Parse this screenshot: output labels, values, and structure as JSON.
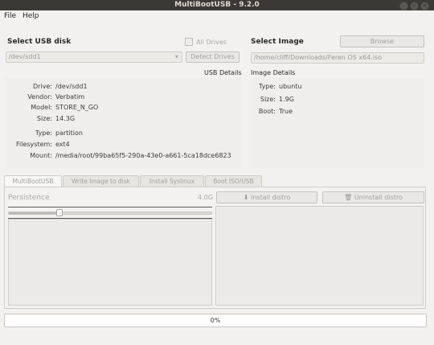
{
  "window": {
    "title": "MultiBootUSB - 9.2.0"
  },
  "menu": {
    "file": "File",
    "help": "Help"
  },
  "usb": {
    "section_label": "Select USB disk",
    "all_drives_label": "All Drives",
    "selected_disk": "/dev/sdd1",
    "detect_button": "Detect Drives",
    "details_label": "USB Details",
    "details": [
      {
        "label": "Drive:",
        "value": "/dev/sdd1"
      },
      {
        "label": "Vendor:",
        "value": "Verbatim"
      },
      {
        "label": "Model:",
        "value": "STORE_N_GO"
      },
      {
        "label": "Size:",
        "value": "14.3G"
      },
      {
        "label": "Type:",
        "value": "partition"
      },
      {
        "label": "Filesystem:",
        "value": "ext4"
      },
      {
        "label": "Mount:",
        "value": "/media/root/99ba65f5-290a-43e0-a661-5ca18dce6823"
      }
    ]
  },
  "image": {
    "section_label": "Select Image",
    "browse_button": "Browse",
    "path": "/home/cliff/Downloads/Feren OS x64.iso",
    "details_label": "Image Details",
    "details": [
      {
        "label": "Type:",
        "value": "ubuntu"
      },
      {
        "label": "Size:",
        "value": "1.9G"
      },
      {
        "label": "Boot:",
        "value": "True"
      }
    ]
  },
  "tabs": [
    {
      "label": "MultiBootUSB"
    },
    {
      "label": "Write Image to disk"
    },
    {
      "label": "Install Syslinux"
    },
    {
      "label": "Boot ISO/USB"
    }
  ],
  "multiboot": {
    "persistence_label": "Persistence",
    "persistence_value": "4.0G",
    "slider_fraction": 0.25,
    "install_button": "Install distro",
    "uninstall_button": "Uninstall distro"
  },
  "progress": {
    "text": "0%",
    "value": 0
  }
}
